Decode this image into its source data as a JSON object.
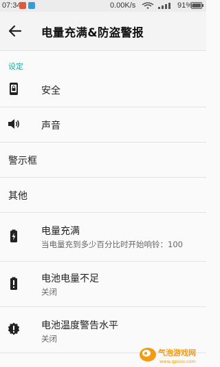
{
  "status_bar": {
    "time": "07:34",
    "net_speed": "0.00K/s",
    "battery_percent": "91%"
  },
  "app_bar": {
    "title": "电量充满&防盗警报",
    "back_icon": "arrow-back-icon"
  },
  "section": {
    "title": "设定"
  },
  "items": [
    {
      "label": "安全",
      "icon": "phone-lock-icon"
    },
    {
      "label": "声音",
      "icon": "volume-icon"
    },
    {
      "label": "警示框"
    },
    {
      "label": "其他"
    },
    {
      "label": "电量充满",
      "summary": "当电量充到多少百分比时开始响铃：100",
      "icon": "battery-charging-icon"
    },
    {
      "label": "电池电量不足",
      "summary": "关闭",
      "icon": "battery-alert-icon"
    },
    {
      "label": "电池温度警告水平",
      "summary": "关闭",
      "icon": "temperature-alert-icon"
    }
  ],
  "watermark": {
    "text": "气泡游戏网",
    "url_text": "www.qpsoo.com"
  },
  "colors": {
    "accent": "#26a69a",
    "watermark_orange": "#f39c12"
  }
}
